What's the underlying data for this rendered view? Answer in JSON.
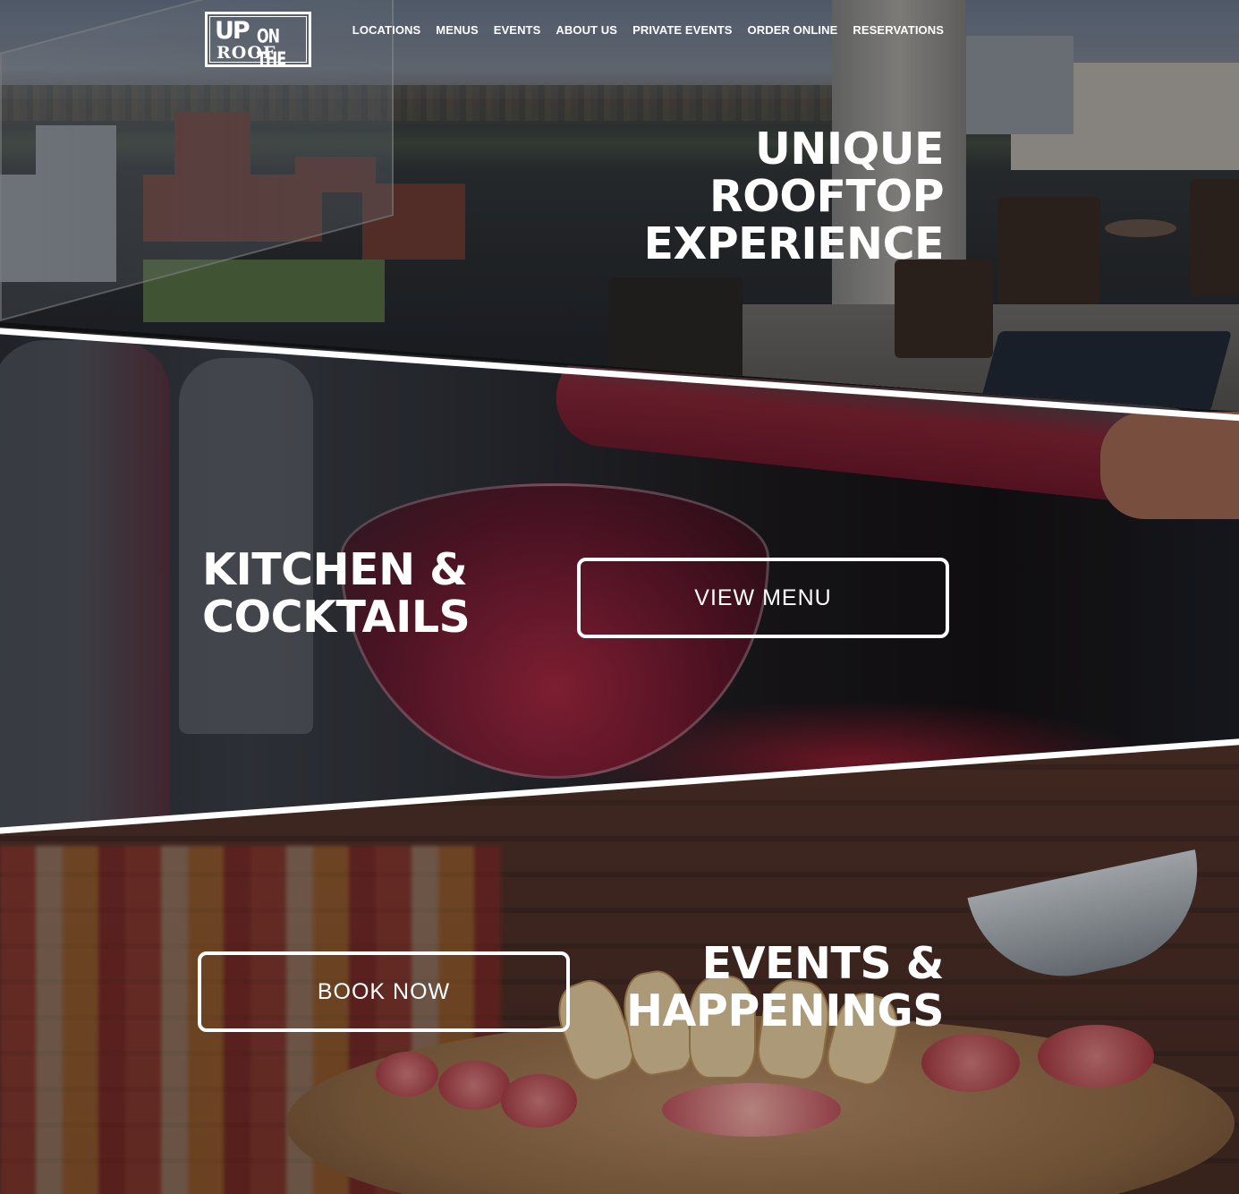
{
  "brand": {
    "logo_line1": "UP",
    "logo_line2": "ON THE",
    "logo_line3": "ROOF"
  },
  "nav": {
    "items": [
      {
        "label": "LOCATIONS"
      },
      {
        "label": "MENUS"
      },
      {
        "label": "EVENTS"
      },
      {
        "label": "ABOUT US"
      },
      {
        "label": "PRIVATE EVENTS"
      },
      {
        "label": "ORDER ONLINE"
      },
      {
        "label": "RESERVATIONS"
      }
    ]
  },
  "hero": {
    "line1": "UNIQUE",
    "line2": "ROOFTOP",
    "line3": "EXPERIENCE"
  },
  "kitchen": {
    "line1": "KITCHEN &",
    "line2": "COCKTAILS",
    "button": "VIEW MENU"
  },
  "events": {
    "line1": "EVENTS &",
    "line2": "HAPPENINGS",
    "button": "BOOK NOW"
  },
  "colors": {
    "text": "#ffffff",
    "divider": "#ffffff"
  }
}
